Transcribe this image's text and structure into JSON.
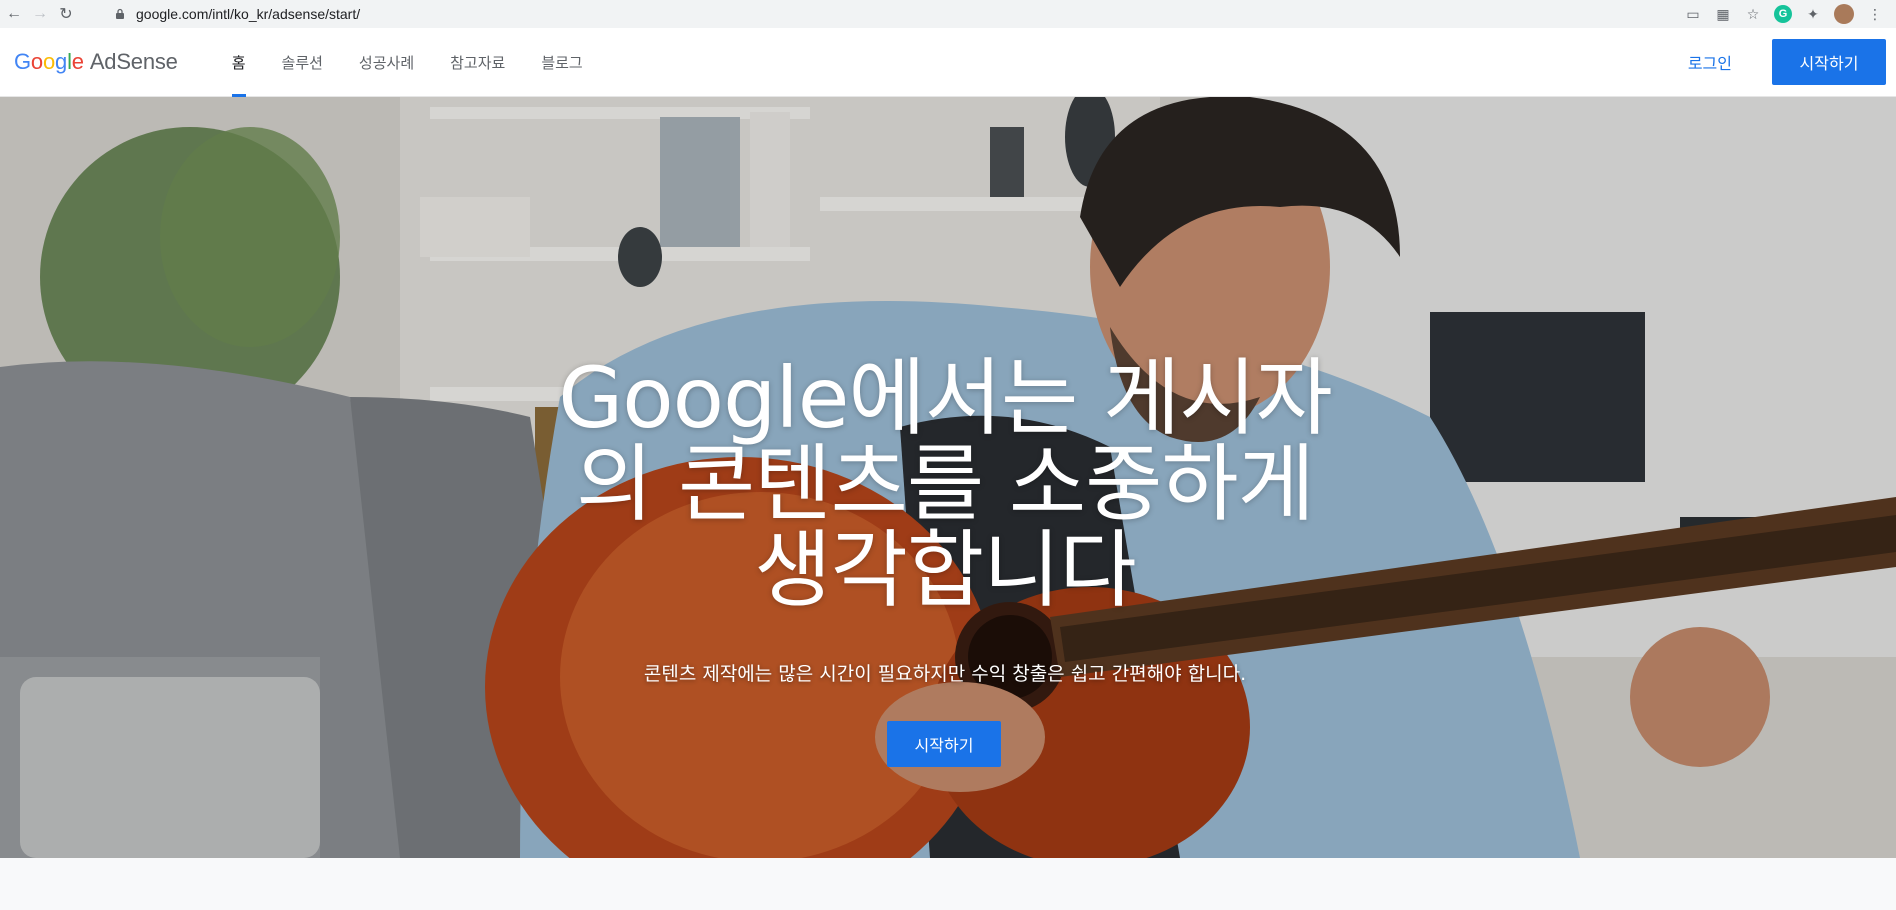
{
  "browser": {
    "url": "google.com/intl/ko_kr/adsense/start/"
  },
  "header": {
    "logo_google": "Google",
    "logo_product": "AdSense",
    "nav": [
      {
        "label": "홈"
      },
      {
        "label": "솔루션"
      },
      {
        "label": "성공사례"
      },
      {
        "label": "참고자료"
      },
      {
        "label": "블로그"
      }
    ],
    "login_label": "로그인",
    "start_label": "시작하기"
  },
  "hero": {
    "title_line1": "Google에서는 게시자",
    "title_line2": "의 콘텐츠를 소중하게",
    "title_line3": "생각합니다",
    "subtitle": "콘텐츠 제작에는 많은 시간이 필요하지만 수익 창출은 쉽고 간편해야 합니다.",
    "cta_label": "시작하기"
  },
  "colors": {
    "accent": "#1a73e8",
    "nav_text": "#5f6368"
  }
}
